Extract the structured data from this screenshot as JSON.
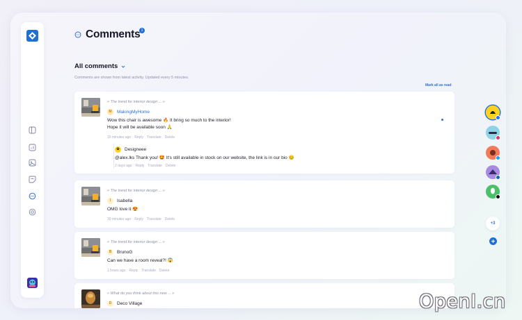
{
  "page": {
    "title": "Comments",
    "title_badge": "1",
    "filter_label": "All comments",
    "subtitle": "Comments are shown from latest activity. Updated every 5 minutes.",
    "mark_all_read": "Mark all as read"
  },
  "sidebar": {
    "items": [
      {
        "icon": "dashboard-icon"
      },
      {
        "icon": "analytics-icon"
      },
      {
        "icon": "media-icon"
      },
      {
        "icon": "notes-icon"
      },
      {
        "icon": "comments-icon",
        "active": true
      },
      {
        "icon": "settings-icon"
      }
    ]
  },
  "actions": {
    "reply": "Reply",
    "translate": "Translate",
    "delete": "Delete"
  },
  "comments": [
    {
      "post": "« The trend for interior design ... »",
      "author": "MakingMyHome",
      "initial": "M",
      "text_line1": "Wow this chair is awesome 🔥 It bring so much to the interior!",
      "text_line2": "Hope it will be available soon 🙏",
      "time": "15 minutes ago",
      "reply": {
        "author": "Designeee",
        "text": "@alex.lks Thank you! 🤩 It's still available in stock on our website, the link is in our bio 😊",
        "time": "2 days ago"
      }
    },
    {
      "post": "« The trend for interior design ... »",
      "author": "Isabella",
      "initial": "I",
      "text_line1": "OMG love it 😍",
      "time": "30 minutes ago"
    },
    {
      "post": "« The trend for interior design ... »",
      "author": "BrunoG",
      "initial": "B",
      "text_line1": "Can we have a room reveal?! 😱",
      "time": "1 hours ago"
    },
    {
      "post": "« What do you think about this new ... »",
      "author": "Deco Village",
      "initial": "D"
    }
  ],
  "accounts": {
    "more_label": "+3",
    "items": [
      {
        "network": "facebook",
        "color": "#1877f2"
      },
      {
        "network": "instagram",
        "color": "#e1306c"
      },
      {
        "network": "twitter",
        "color": "#1da1f2"
      },
      {
        "network": "linkedin",
        "color": "#0a66c2"
      },
      {
        "network": "tiktok",
        "color": "#111111"
      }
    ]
  },
  "colors": {
    "accent": "#2f6fd6",
    "brand": "#1f6fd6"
  },
  "watermark": "OpenI.cn"
}
